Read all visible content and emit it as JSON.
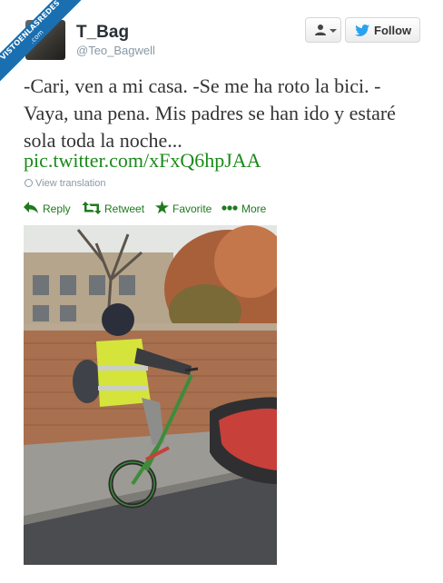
{
  "watermark": {
    "line1": "VISTOENLASREDES",
    "line2": ".com"
  },
  "user": {
    "display_name": "T_Bag",
    "handle": "@Teo_Bagwell"
  },
  "buttons": {
    "follow": "Follow"
  },
  "tweet": {
    "text": "-Cari, ven a mi casa. -Se me ha roto la bici. -Vaya, una pena. Mis padres se han ido y estaré sola toda la noche...",
    "link": "pic.twitter.com/xFxQ6hpJAA",
    "translate": "View translation"
  },
  "actions": {
    "reply": "Reply",
    "retweet": "Retweet",
    "favorite": "Favorite",
    "more": "More"
  },
  "colors": {
    "link_green": "#1a8a1a",
    "action_green": "#1e7a1e",
    "ribbon_blue": "#1a6fb0"
  }
}
